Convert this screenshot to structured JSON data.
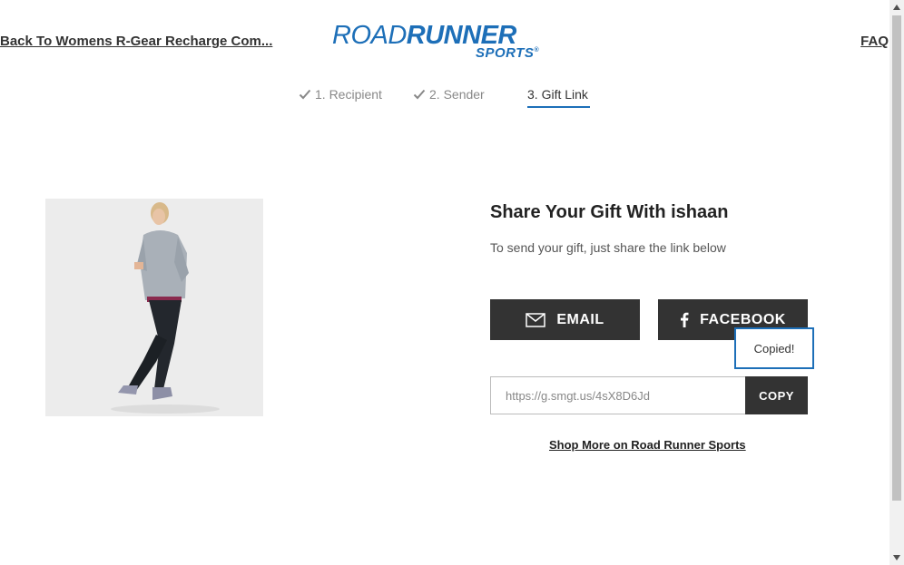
{
  "header": {
    "back_link": "Back To Womens R-Gear Recharge Com...",
    "faq_link": "FAQ",
    "logo": {
      "line1_bold": "ROAD",
      "line1_rest": "RUNNER",
      "line2": "SPORTS",
      "reg": "®"
    }
  },
  "steps": [
    {
      "label": "1. Recipient",
      "status": "complete",
      "icon": "check-icon"
    },
    {
      "label": "2. Sender",
      "status": "complete",
      "icon": "check-icon"
    },
    {
      "label": "3. Gift Link",
      "status": "active"
    }
  ],
  "share": {
    "title": "Share Your Gift With ishaan",
    "subtitle": "To send your gift, just share the link below",
    "email_label": "EMAIL",
    "facebook_label": "FACEBOOK",
    "link_value": "https://g.smgt.us/4sX8D6Jd",
    "copy_label": "COPY",
    "copied_tooltip": "Copied!",
    "shop_more": "Shop More on Road Runner Sports"
  },
  "colors": {
    "accent": "#1d6fb8",
    "button_bg": "#333333"
  }
}
